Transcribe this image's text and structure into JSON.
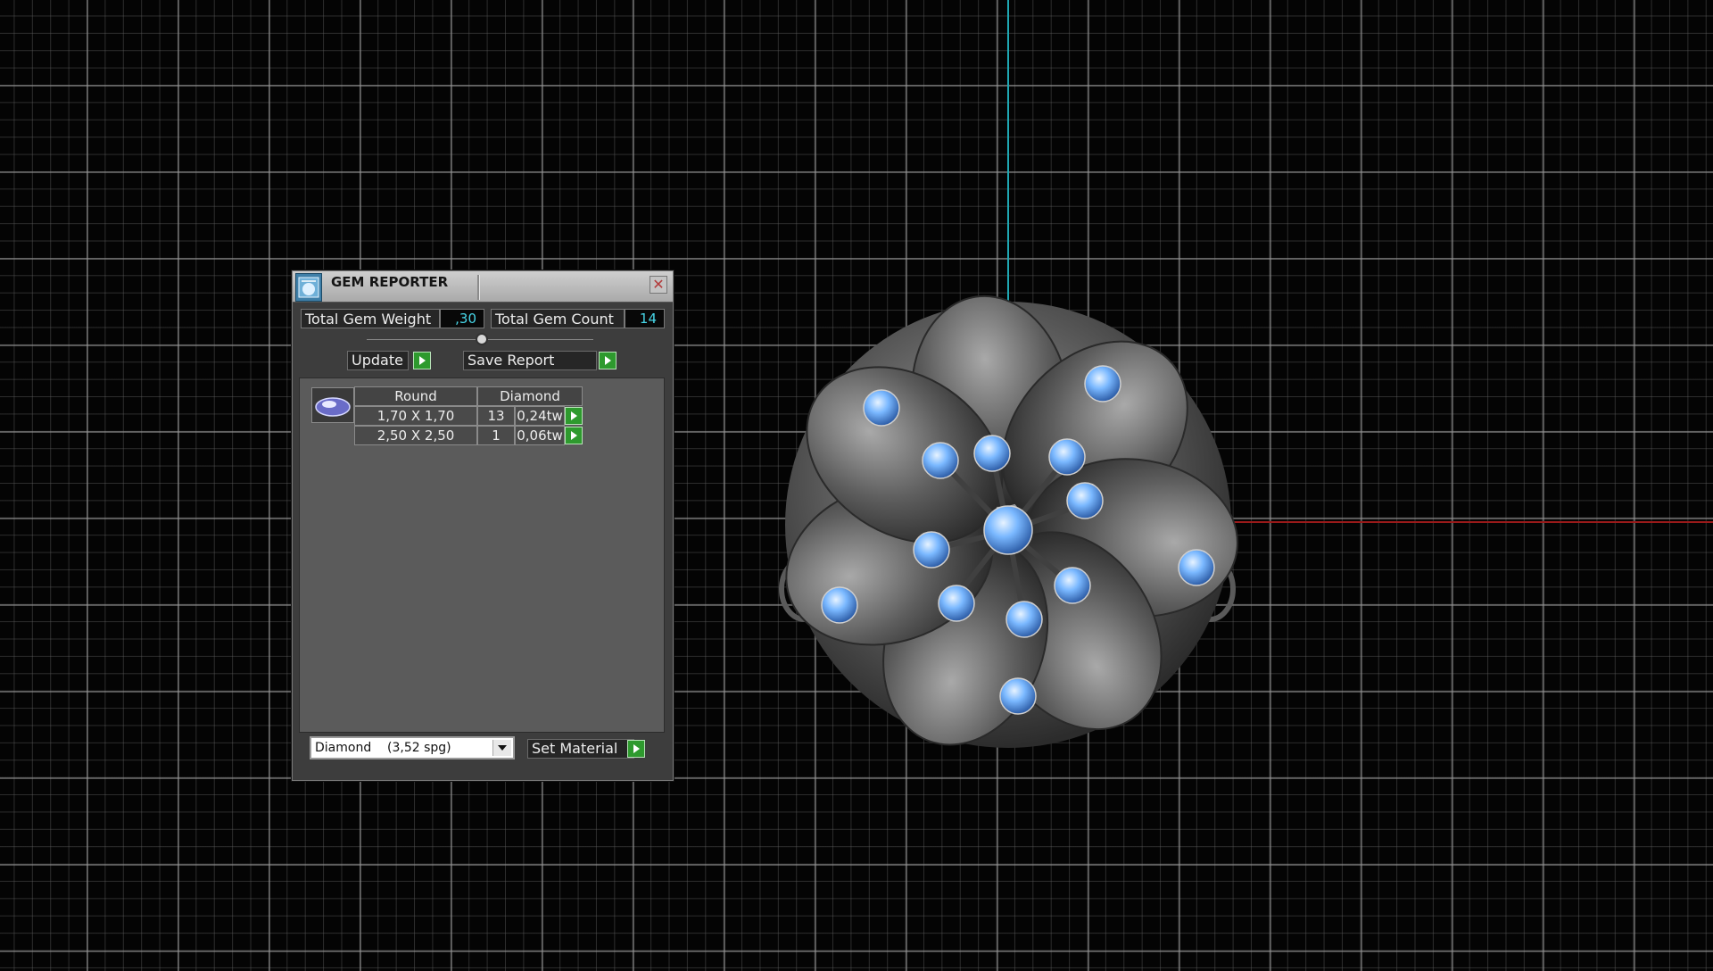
{
  "dialog": {
    "title": "GEM REPORTER",
    "close_glyph": "✕",
    "total_gem_weight_label": "Total Gem Weight",
    "total_gem_weight_value": ",30",
    "total_gem_count_label": "Total Gem Count",
    "total_gem_count_value": "14",
    "update_label": "Update",
    "save_report_label": "Save Report",
    "table": {
      "header_shape": "Round",
      "header_material": "Diamond",
      "rows": [
        {
          "size": "1,70 X 1,70",
          "count": "13",
          "weight": "0,24tw"
        },
        {
          "size": "2,50 X 2,50",
          "count": "1",
          "weight": "0,06tw"
        }
      ]
    },
    "material_select_value": "Diamond    (3,52 spg)",
    "set_material_label": "Set Material"
  },
  "colors": {
    "accent_value": "#47d6e8",
    "go_button": "#2e9a2e",
    "axis_y": "#1fa8b3",
    "axis_x": "#9a1a1a",
    "gem": "#7ab8ff",
    "metal": "#6e6e6e"
  },
  "icons": {
    "dialog": "gem-reporter-app-icon",
    "close": "close-icon",
    "go": "play-arrow-icon",
    "gem": "round-gem-icon",
    "dropdown": "chevron-down-icon"
  }
}
